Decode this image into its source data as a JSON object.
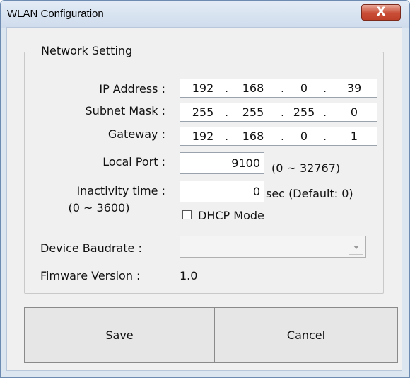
{
  "window": {
    "title": "WLAN Configuration",
    "close_glyph": "X"
  },
  "network": {
    "group_label": "Network Setting",
    "ip": {
      "label": "IP Address :",
      "octets": [
        "192",
        "168",
        "0",
        "39"
      ]
    },
    "subnet": {
      "label": "Subnet Mask :",
      "octets": [
        "255",
        "255",
        "255",
        "0"
      ]
    },
    "gateway": {
      "label": "Gateway :",
      "octets": [
        "192",
        "168",
        "0",
        "1"
      ]
    },
    "dot": ".",
    "local_port": {
      "label": "Local Port :",
      "value": "9100",
      "range": "(0 ~ 32767)"
    },
    "inactivity": {
      "label_line1": "Inactivity time :",
      "label_line2": "(0 ~ 3600)",
      "value": "0",
      "suffix": "sec (Default: 0)"
    },
    "dhcp": {
      "label": "DHCP Mode",
      "checked": false
    },
    "baudrate": {
      "label": "Device Baudrate :",
      "value": ""
    },
    "firmware": {
      "label": "Fimware Version :",
      "value": "1.0"
    }
  },
  "buttons": {
    "save": "Save",
    "cancel": "Cancel"
  }
}
